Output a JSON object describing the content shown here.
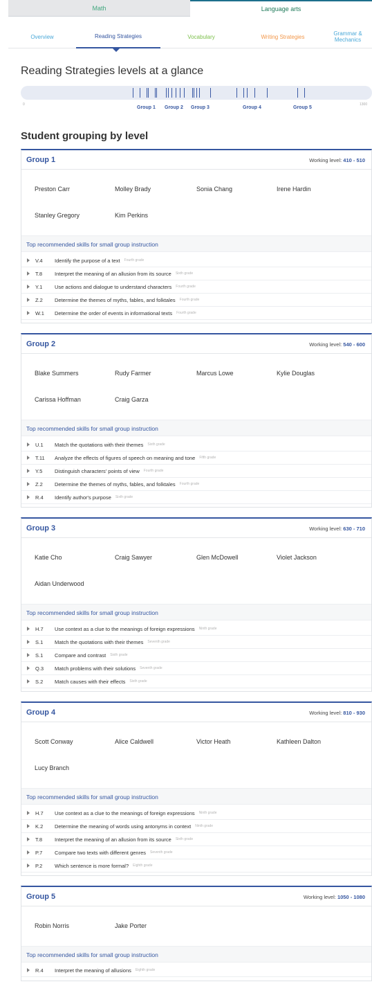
{
  "subjects": [
    "Math",
    "Language arts"
  ],
  "subnav": [
    "Overview",
    "Reading Strategies",
    "Vocabulary",
    "Writing Strategies",
    "Grammar & Mechanics"
  ],
  "colors": {
    "overview": "#4aa8d8",
    "reading": "#3556a0",
    "vocabulary": "#7bbf4a",
    "writing": "#f2974a",
    "grammar": "#4aa8d8"
  },
  "heading": "Reading Strategies levels at a glance",
  "level_bar": {
    "min_label": "0",
    "max_label": "1300",
    "group_labels": [
      "Group 1",
      "Group 2",
      "Group 3",
      "Group 4",
      "Group 5"
    ]
  },
  "grouping_heading": "Student grouping by level",
  "skills_heading": "Top recommended skills for small group instruction",
  "working_level_label": "Working level:",
  "groups": [
    {
      "name": "Group 1",
      "working_level": "410 - 510",
      "students": [
        "Preston Carr",
        "Molley Brady",
        "Sonia Chang",
        "Irene Hardin",
        "Stanley Gregory",
        "Kim Perkins"
      ],
      "skills": [
        {
          "code": "V.4",
          "name": "Identify the purpose of a text",
          "grade": "Fourth grade"
        },
        {
          "code": "T.8",
          "name": "Interpret the meaning of an allusion from its source",
          "grade": "Sixth grade"
        },
        {
          "code": "Y.1",
          "name": "Use actions and dialogue to understand characters",
          "grade": "Fourth grade"
        },
        {
          "code": "Z.2",
          "name": "Determine the themes of myths, fables, and folktales",
          "grade": "Fourth grade"
        },
        {
          "code": "W.1",
          "name": "Determine the order of events in informational texts",
          "grade": "Fourth grade"
        }
      ]
    },
    {
      "name": "Group 2",
      "working_level": "540 - 600",
      "students": [
        "Blake Summers",
        "Rudy Farmer",
        "Marcus Lowe",
        "Kylie Douglas",
        "Carissa Hoffman",
        "Craig Garza"
      ],
      "skills": [
        {
          "code": "U.1",
          "name": "Match the quotations with their themes",
          "grade": "Sixth grade"
        },
        {
          "code": "T.11",
          "name": "Analyze the effects of figures of speech on meaning and tone",
          "grade": "Fifth grade"
        },
        {
          "code": "Y.5",
          "name": "Distinguish characters' points of view",
          "grade": "Fourth grade"
        },
        {
          "code": "Z.2",
          "name": "Determine the themes of myths, fables, and folktales",
          "grade": "Fourth grade"
        },
        {
          "code": "R.4",
          "name": "Identify author's purpose",
          "grade": "Sixth grade"
        }
      ]
    },
    {
      "name": "Group 3",
      "working_level": "630 - 710",
      "students": [
        "Katie Cho",
        "Craig Sawyer",
        "Glen McDowell",
        "Violet Jackson",
        "Aidan Underwood"
      ],
      "skills": [
        {
          "code": "H.7",
          "name": "Use context as a clue to the meanings of foreign expressions",
          "grade": "Ninth grade"
        },
        {
          "code": "S.1",
          "name": "Match the quotations with their themes",
          "grade": "Seventh grade"
        },
        {
          "code": "S.1",
          "name": "Compare and contrast",
          "grade": "Sixth grade"
        },
        {
          "code": "Q.3",
          "name": "Match problems with their solutions",
          "grade": "Seventh grade"
        },
        {
          "code": "S.2",
          "name": "Match causes with their effects",
          "grade": "Sixth grade"
        }
      ]
    },
    {
      "name": "Group 4",
      "working_level": "810 - 930",
      "students": [
        "Scott Conway",
        "Alice Caldwell",
        "Victor Heath",
        "Kathleen Dalton",
        "Lucy Branch"
      ],
      "skills": [
        {
          "code": "H.7",
          "name": "Use context as a clue to the meanings of foreign expressions",
          "grade": "Ninth grade"
        },
        {
          "code": "K.2",
          "name": "Determine the meaning of words using antonyms in context",
          "grade": "Ninth grade"
        },
        {
          "code": "T.8",
          "name": "Interpret the meaning of an allusion from its source",
          "grade": "Sixth grade"
        },
        {
          "code": "P.7",
          "name": "Compare two texts with different genres",
          "grade": "Seventh grade"
        },
        {
          "code": "P.2",
          "name": "Which sentence is more formal?",
          "grade": "Eighth grade"
        }
      ]
    },
    {
      "name": "Group 5",
      "working_level": "1050 - 1080",
      "students": [
        "Robin Norris",
        "Jake Porter"
      ],
      "skills": [
        {
          "code": "R.4",
          "name": "Interpret the meaning of allusions",
          "grade": "Eighth grade"
        }
      ]
    }
  ]
}
